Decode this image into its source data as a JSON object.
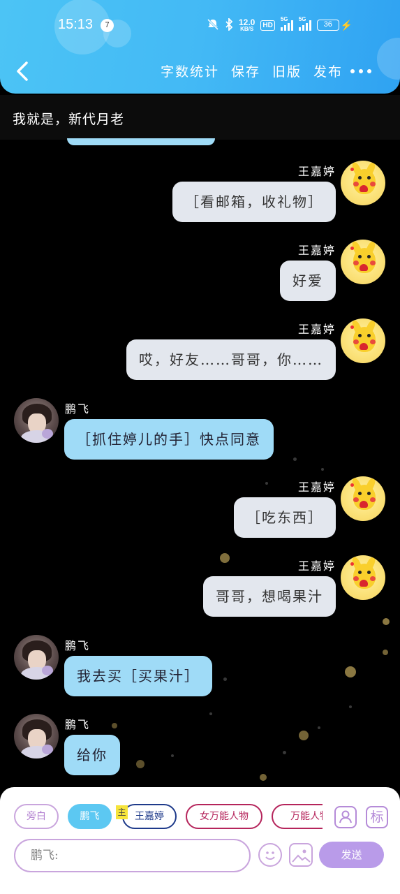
{
  "status_bar": {
    "time": "15:13",
    "notification_count": "7",
    "network_speed": "12.0",
    "network_speed_unit": "KB/S",
    "hd_label": "HD",
    "sim1_label": "5G",
    "sim2_label": "5G",
    "battery": "36"
  },
  "nav": {
    "back_icon": "chevron-left-icon",
    "actions": [
      "字数统计",
      "保存",
      "旧版",
      "发布"
    ],
    "more_icon": "more-dots-icon"
  },
  "story": {
    "title": "我就是，新代月老"
  },
  "messages": [
    {
      "side": "right",
      "name": "王嘉婷",
      "text": "［看邮箱，收礼物］"
    },
    {
      "side": "right",
      "name": "王嘉婷",
      "text": "好爱"
    },
    {
      "side": "right",
      "name": "王嘉婷",
      "text": "哎，好友……哥哥，你……"
    },
    {
      "side": "left",
      "name": "鹏飞",
      "text": "［抓住婷儿的手］快点同意"
    },
    {
      "side": "right",
      "name": "王嘉婷",
      "text": "［吃东西］"
    },
    {
      "side": "right",
      "name": "王嘉婷",
      "text": "哥哥，想喝果汁"
    },
    {
      "side": "left",
      "name": "鹏飞",
      "text": "我去买［买果汁］"
    },
    {
      "side": "left",
      "name": "鹏飞",
      "text": "给你"
    }
  ],
  "composer": {
    "roles": [
      "旁白",
      "鹏飞",
      "王嘉婷",
      "女万能人物",
      "万能人物"
    ],
    "selected_role": "鹏飞",
    "main_badge": "主",
    "tag_button": "标",
    "input_value": "鹏飞:",
    "send_label": "发送",
    "colors": {
      "accent": "#b99be9",
      "selected": "#5cc8f2",
      "header": "#43b9f5"
    }
  }
}
